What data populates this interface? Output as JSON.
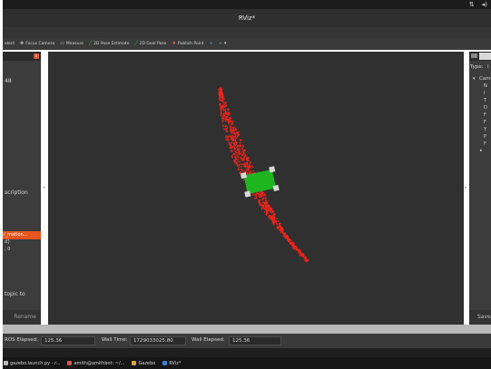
{
  "app": {
    "window_title": "RViz*"
  },
  "topbar": {
    "icons": [
      {
        "name": "network-icon",
        "glyph": "⇅"
      },
      {
        "name": "volume-icon",
        "glyph": "◂)"
      }
    ]
  },
  "toolbar": {
    "items": [
      {
        "label": "elect",
        "icon": "select-cursor-icon",
        "glyph": "",
        "color": "#cfcfcf"
      },
      {
        "label": "Focus Camera",
        "icon": "focus-camera-icon",
        "glyph": "✥",
        "color": "#cfcfcf"
      },
      {
        "label": "Measure",
        "icon": "measure-icon",
        "glyph": "▭",
        "color": "#cfcfcf"
      },
      {
        "label": "2D Pose Estimate",
        "icon": "pose-estimate-arrow-icon",
        "glyph": "╱",
        "color": "#4caf50"
      },
      {
        "label": "2D Goal Pose",
        "icon": "goal-pose-arrow-icon",
        "glyph": "╱",
        "color": "#4caf50"
      },
      {
        "label": "Publish Point",
        "icon": "publish-point-icon",
        "glyph": "♦",
        "color": "#e05a4f"
      },
      {
        "label": "",
        "icon": "add-tool-icon",
        "glyph": "+",
        "color": "#5aa3e0"
      },
      {
        "label": "",
        "icon": "remove-tool-icon",
        "glyph": "−",
        "color": "#cfcfcf"
      },
      {
        "label": "",
        "icon": "tool-menu-icon",
        "glyph": "▾",
        "color": "#cfcfcf"
      }
    ]
  },
  "left_panel": {
    "close_glyph": "×",
    "text_48": "48",
    "description": "scription",
    "highlight": "/_mation...",
    "line_d": "d}",
    "line_s0": "; 0",
    "topic": "topic to",
    "rename": "Rename"
  },
  "right_panel": {
    "type_label": "Type:",
    "type_value": "I",
    "tree_root": "Cam",
    "tree_items": [
      "N",
      "I",
      "T",
      "D",
      "F",
      "F",
      "Y",
      "P",
      "F"
    ],
    "save": "Save"
  },
  "timebar": {
    "ros_elapsed_label": "ROS Elapsed:",
    "ros_elapsed_value": "125.36",
    "wall_time_label": "Wall Time:",
    "wall_time_value": "1729033025.80",
    "wall_elapsed_label": "Wall Elapsed:",
    "wall_elapsed_value": "125.36"
  },
  "taskbar": {
    "items": [
      {
        "label": "gazebo.launch.py - r...",
        "icon": "terminal-icon",
        "color": "#bcbcbc"
      },
      {
        "label": "amith@amithbot: ~/...",
        "icon": "terminal-red-icon",
        "color": "#d9534f"
      },
      {
        "label": "Gazebo",
        "icon": "gazebo-icon",
        "color": "#e0a040"
      },
      {
        "label": "RViz*",
        "icon": "rviz-icon",
        "color": "#3c7fd0"
      }
    ]
  },
  "scene": {
    "robot_color": "#1fb51f",
    "laser_color": "#e8241c",
    "background_color": "#303030"
  }
}
